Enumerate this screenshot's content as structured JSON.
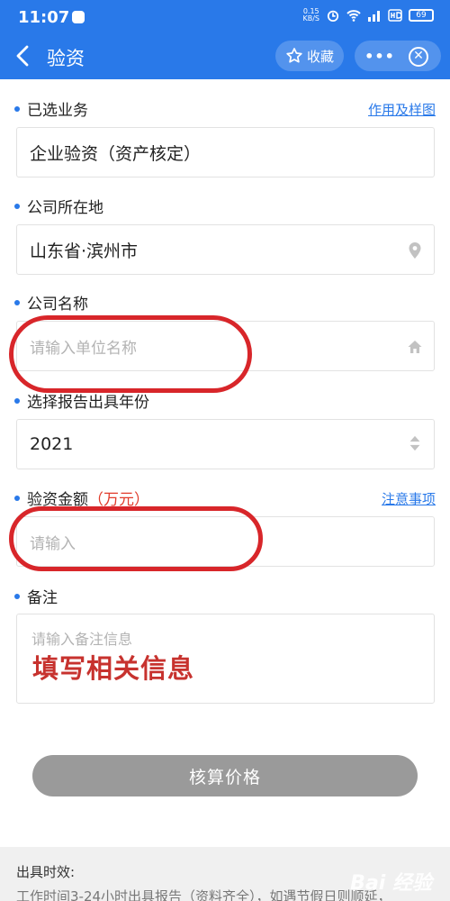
{
  "status": {
    "time": "11:07",
    "speed_top": "0.15",
    "speed_bottom": "KB/S",
    "battery": "69"
  },
  "navbar": {
    "title": "验资",
    "favorite_label": "收藏",
    "more_label": "•••"
  },
  "sections": {
    "business": {
      "label": "已选业务",
      "link": "作用及样图",
      "value": "企业验资（资产核定）"
    },
    "location": {
      "label": "公司所在地",
      "value": "山东省·滨州市"
    },
    "company": {
      "label": "公司名称",
      "placeholder": "请输入单位名称"
    },
    "year": {
      "label": "选择报告出具年份",
      "value": "2021"
    },
    "amount": {
      "label_prefix": "验资金额",
      "label_unit": "（万元）",
      "link": "注意事项",
      "placeholder": "请输入"
    },
    "remarks": {
      "label": "备注",
      "placeholder": "请输入备注信息"
    }
  },
  "annotation": "填写相关信息",
  "calc_button": "核算价格",
  "footer": {
    "title": "出具时效:",
    "desc": "工作时间3-24小时出具报告（资料齐全），如遇节假日则顺延，"
  },
  "watermark": "Bai 经验",
  "icons": [
    "back-icon",
    "star-icon",
    "close-icon",
    "location-pin-icon",
    "home-icon",
    "updown-arrow-icon"
  ],
  "colors": {
    "brand": "#2979e9",
    "highlight": "#d8262a",
    "unit_red": "#e13c2c"
  }
}
